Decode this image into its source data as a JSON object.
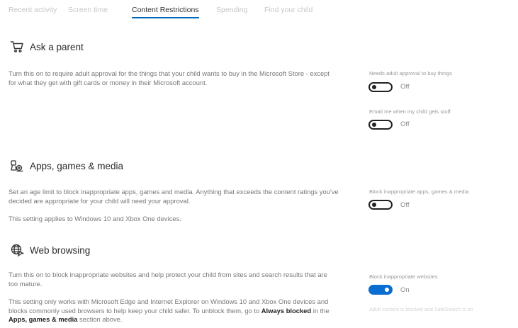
{
  "tabs": [
    {
      "label": "Recent activity",
      "active": false
    },
    {
      "label": "Screen time",
      "active": false
    },
    {
      "label": "Content Restrictions",
      "active": true
    },
    {
      "label": "Spending",
      "active": false
    },
    {
      "label": "Find your child",
      "active": false
    }
  ],
  "ask_parent": {
    "title": "Ask a parent",
    "icon": "cart-icon",
    "description": "Turn this on to require adult approval for the things that your child wants to buy in the Microsoft Store - except for what they get with gift cards or money in their Microsoft account.",
    "settings": [
      {
        "label": "Needs adult approval to buy things",
        "state": "Off",
        "on": false
      },
      {
        "label": "Email me when my child gets stuff",
        "state": "Off",
        "on": false
      }
    ]
  },
  "apps": {
    "title": "Apps, games & media",
    "icon": "apps-games-media-icon",
    "description": "Set an age limit to block inappropriate apps, games and media. Anything that exceeds the content ratings you've decided are appropriate for your child will need your approval.",
    "note": "This setting applies to Windows 10 and Xbox One devices.",
    "setting": {
      "label": "Block inappropriate apps, games & media",
      "state": "Off",
      "on": false
    }
  },
  "web": {
    "title": "Web browsing",
    "icon": "globe-icon",
    "description": "Turn this on to block inappropriate websites and help protect your child from sites and search results that are too mature.",
    "note_part1": "This setting only works with Microsoft Edge and Internet Explorer on Windows 10 and Xbox One devices and blocks commonly used browsers to help keep your child safer. To unblock them, go to ",
    "note_bold1": "Always blocked",
    "note_part2": " in the ",
    "note_bold2": "Apps, games & media",
    "note_part3": " section above.",
    "setting": {
      "label": "Block inappropriate websites",
      "state": "On",
      "on": true
    },
    "faded_text": "Adult content is blocked and SafeSearch is on"
  },
  "colors": {
    "accent": "#0067b8",
    "toggle_on": "#0a6ed1"
  }
}
